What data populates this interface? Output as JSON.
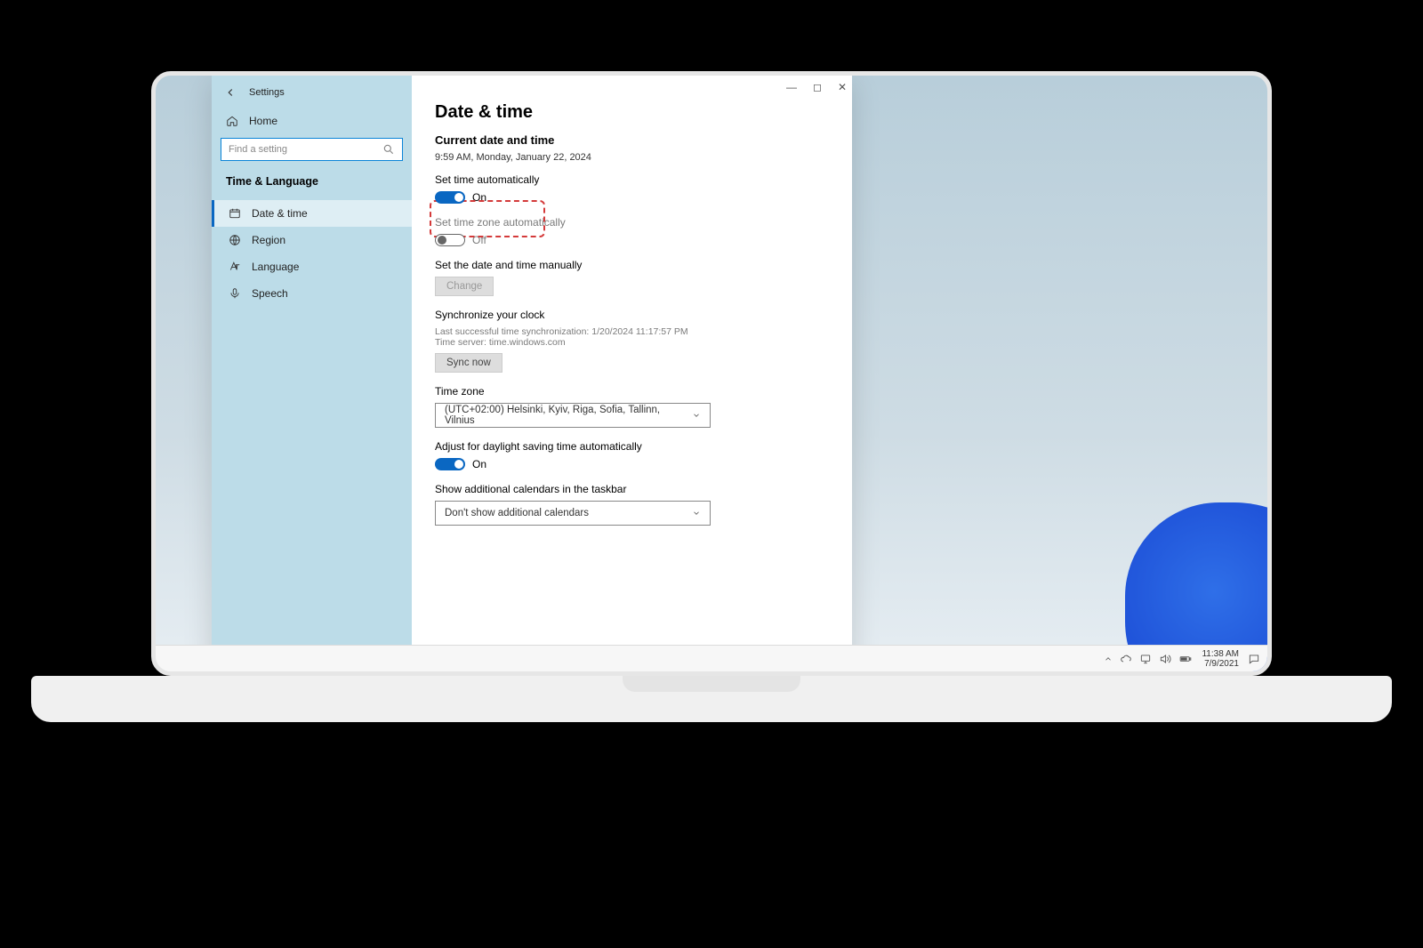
{
  "window": {
    "app_name": "Settings",
    "page_title": "Date & time",
    "controls": {
      "min": "—",
      "max": "◻",
      "close": "✕"
    }
  },
  "sidebar": {
    "home_label": "Home",
    "search_placeholder": "Find a setting",
    "heading": "Time & Language",
    "items": [
      {
        "label": "Date & time",
        "active": true
      },
      {
        "label": "Region",
        "active": false
      },
      {
        "label": "Language",
        "active": false
      },
      {
        "label": "Speech",
        "active": false
      }
    ]
  },
  "content": {
    "current_heading": "Current date and time",
    "current_value": "9:59 AM, Monday, January 22, 2024",
    "set_time_auto": {
      "label": "Set time automatically",
      "state_text": "On",
      "on": true
    },
    "set_tz_auto": {
      "label": "Set time zone automatically",
      "state_text": "Off",
      "on": false
    },
    "set_manual": {
      "label": "Set the date and time manually",
      "button": "Change"
    },
    "sync": {
      "heading": "Synchronize your clock",
      "last": "Last successful time synchronization: 1/20/2024 11:17:57 PM",
      "server": "Time server: time.windows.com",
      "button": "Sync now"
    },
    "timezone": {
      "heading": "Time zone",
      "value": "(UTC+02:00) Helsinki, Kyiv, Riga, Sofia, Tallinn, Vilnius"
    },
    "dst": {
      "label": "Adjust for daylight saving time automatically",
      "state_text": "On",
      "on": true
    },
    "calendars": {
      "label": "Show additional calendars in the taskbar",
      "value": "Don't show additional calendars"
    }
  },
  "taskbar": {
    "time": "11:38 AM",
    "date": "7/9/2021"
  }
}
